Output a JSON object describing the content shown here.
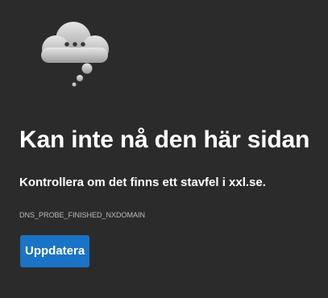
{
  "error": {
    "title": "Kan inte nå den här sidan",
    "suggestion": "Kontrollera om det finns ett stavfel i xxl.se.",
    "code": "DNS_PROBE_FINISHED_NXDOMAIN",
    "icon": "cloud-thinking-icon"
  },
  "actions": {
    "reload_label": "Uppdatera"
  },
  "colors": {
    "background": "#2b2b2b",
    "button": "#1a73c6",
    "text": "#ffffff",
    "muted_text": "#bdbdbd"
  }
}
